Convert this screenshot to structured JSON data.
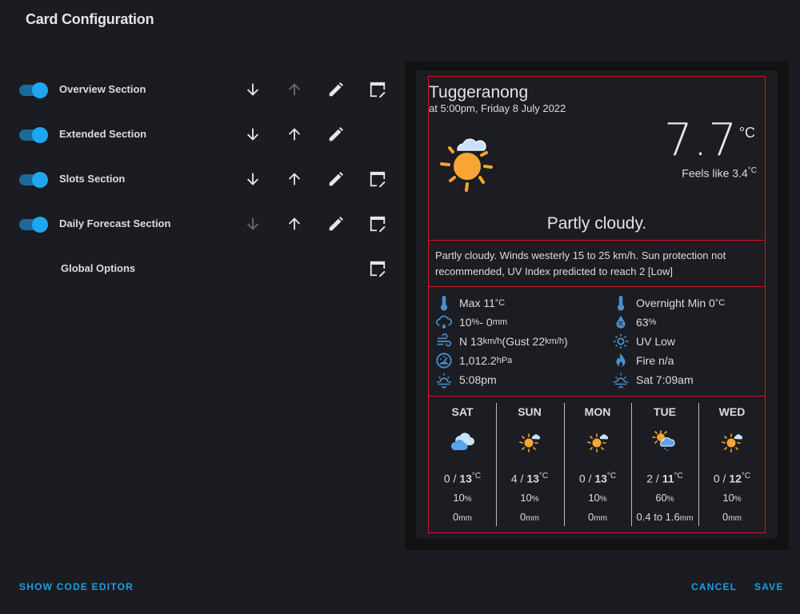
{
  "dialog": {
    "title": "Card Configuration"
  },
  "sections": [
    {
      "label": "Overview Section",
      "enabled": true,
      "down_enabled": true,
      "up_enabled": false,
      "has_edit": true,
      "has_card": true
    },
    {
      "label": "Extended Section",
      "enabled": true,
      "down_enabled": true,
      "up_enabled": true,
      "has_edit": true,
      "has_card": false
    },
    {
      "label": "Slots Section",
      "enabled": true,
      "down_enabled": true,
      "up_enabled": true,
      "has_edit": true,
      "has_card": true
    },
    {
      "label": "Daily Forecast Section",
      "enabled": true,
      "down_enabled": false,
      "up_enabled": true,
      "has_edit": true,
      "has_card": true
    }
  ],
  "global_options": {
    "label": "Global Options"
  },
  "preview": {
    "overview": {
      "location": "Tuggeranong",
      "timestamp": "at 5:00pm, Friday 8 July 2022",
      "icon": "partly-cloudy-day-icon",
      "temperature": "7.7",
      "temperature_unit": "°C",
      "feels_like_label": "Feels like 3.4",
      "feels_like_unit": "°C",
      "summary": "Partly cloudy."
    },
    "extended": {
      "text": "Partly cloudy. Winds westerly 15 to 25 km/h. Sun protection not recommended, UV Index predicted to reach 2 [Low]"
    },
    "slots": {
      "left": [
        {
          "icon": "thermometer-icon",
          "text": "Max 11",
          "unit": "°C"
        },
        {
          "icon": "rain-cloud-icon",
          "text": "10",
          "unit": "%",
          "text2": " - 0",
          "unit2": "mm"
        },
        {
          "icon": "wind-icon",
          "text": "N 13",
          "unit": "km/h",
          "text2": " (Gust 22",
          "unit2": "km/h",
          "text3": ")"
        },
        {
          "icon": "gauge-icon",
          "text": "1,012.2",
          "unit": "hPa"
        },
        {
          "icon": "sunset-icon",
          "text": "5:08pm"
        }
      ],
      "right": [
        {
          "icon": "thermometer-icon",
          "text": "Overnight Min 0",
          "unit": "°C"
        },
        {
          "icon": "humidity-icon",
          "text": "63",
          "unit": "%"
        },
        {
          "icon": "uv-sun-icon",
          "text": "UV Low"
        },
        {
          "icon": "fire-icon",
          "text": "Fire n/a"
        },
        {
          "icon": "sunrise-icon",
          "text": "Sat 7:09am"
        }
      ]
    },
    "daily": [
      {
        "day": "SAT",
        "icon": "cloudy-icon",
        "min": "0",
        "max": "13",
        "unit": "°C",
        "pop": "10",
        "pop_unit": "%",
        "rain": "0",
        "rain_unit": "mm"
      },
      {
        "day": "SUN",
        "icon": "partly-cloudy-day-icon",
        "min": "4",
        "max": "13",
        "unit": "°C",
        "pop": "10",
        "pop_unit": "%",
        "rain": "0",
        "rain_unit": "mm"
      },
      {
        "day": "MON",
        "icon": "partly-cloudy-day-icon",
        "min": "0",
        "max": "13",
        "unit": "°C",
        "pop": "10",
        "pop_unit": "%",
        "rain": "0",
        "rain_unit": "mm"
      },
      {
        "day": "TUE",
        "icon": "showers-day-icon",
        "min": "2",
        "max": "11",
        "unit": "°C",
        "pop": "60",
        "pop_unit": "%",
        "rain": "0.4 to 1.6",
        "rain_unit": "mm"
      },
      {
        "day": "WED",
        "icon": "partly-cloudy-day-icon",
        "min": "0",
        "max": "12",
        "unit": "°C",
        "pop": "10",
        "pop_unit": "%",
        "rain": "0",
        "rain_unit": "mm"
      }
    ]
  },
  "footer": {
    "show_code_editor": "SHOW CODE EDITOR",
    "cancel": "CANCEL",
    "save": "SAVE"
  },
  "colors": {
    "background": "#1a1c21",
    "accent": "#1ea7f0",
    "toggle_track": "#1d6a9a",
    "section_outline": "#d9121f",
    "slot_icon": "#4a8fd0",
    "sun": "#f9a533",
    "cloud_light": "#c9e2fb",
    "cloud_blue": "#57a3ec"
  }
}
